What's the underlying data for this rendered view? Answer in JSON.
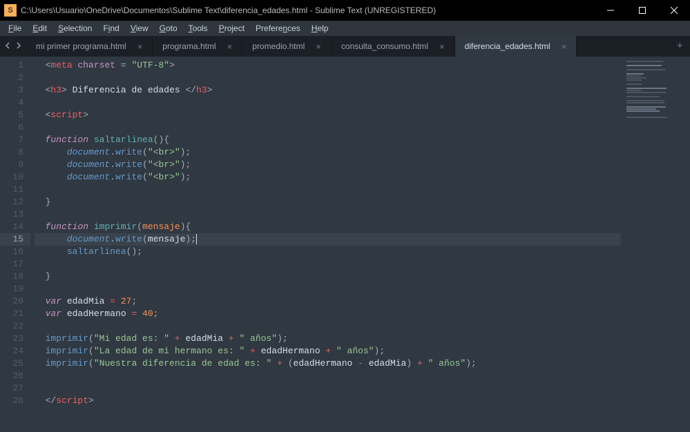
{
  "titlebar": {
    "icon_letter": "S",
    "title": "C:\\Users\\Usuario\\OneDrive\\Documentos\\Sublime Text\\diferencia_edades.html - Sublime Text (UNREGISTERED)"
  },
  "menu": {
    "file": "File",
    "file_u": "F",
    "edit": "Edit",
    "edit_u": "E",
    "selection": "Selection",
    "selection_u": "S",
    "find": "Find",
    "find_u": "i",
    "view": "View",
    "view_u": "V",
    "goto": "Goto",
    "goto_u": "G",
    "tools": "Tools",
    "tools_u": "T",
    "project": "Project",
    "project_u": "P",
    "preferences": "Preferences",
    "preferences_u": "n",
    "help": "Help",
    "help_u": "H"
  },
  "tabs": {
    "items": [
      {
        "label": "mi primer programa.html"
      },
      {
        "label": "programa.html"
      },
      {
        "label": "promedio.html"
      },
      {
        "label": "consulta_consumo.html"
      },
      {
        "label": "diferencia_edades.html"
      }
    ],
    "active_index": 4,
    "plus": "+"
  },
  "lines": {
    "count": 28,
    "highlight": 15
  },
  "code": {
    "l1": {
      "open": "<",
      "tag": "meta",
      "sp": " ",
      "attr": "charset",
      "eq": " = ",
      "str": "\"UTF-8\"",
      "close": ">"
    },
    "l3": {
      "open": "<",
      "tag": "h3",
      "close1": ">",
      "text": " Diferencia de edades ",
      "open2": "</",
      "tag2": "h3",
      "close2": ">"
    },
    "l5": {
      "open": "<",
      "tag": "script",
      "close": ">"
    },
    "l7": {
      "kw": "function",
      "sp": " ",
      "name": "saltarlinea",
      "p": "(){"
    },
    "l8": {
      "ind": "    ",
      "obj": "document",
      "dot": ".",
      "fn": "write",
      "po": "(",
      "str": "\"<br>\"",
      "pc": ");"
    },
    "l9": {
      "ind": "    ",
      "obj": "document",
      "dot": ".",
      "fn": "write",
      "po": "(",
      "str": "\"<br>\"",
      "pc": ");"
    },
    "l10": {
      "ind": "    ",
      "obj": "document",
      "dot": ".",
      "fn": "write",
      "po": "(",
      "str": "\"<br>\"",
      "pc": ");"
    },
    "l12": {
      "b": "}"
    },
    "l14": {
      "kw": "function",
      "sp": " ",
      "name": "imprimir",
      "po": "(",
      "param": "mensaje",
      "pc": "){"
    },
    "l15": {
      "ind": "    ",
      "obj": "document",
      "dot": ".",
      "fn": "write",
      "po": "(",
      "arg": "mensaje",
      "pc": ");"
    },
    "l16": {
      "ind": "    ",
      "fn": "saltarlinea",
      "p": "();"
    },
    "l18": {
      "b": "}"
    },
    "l20": {
      "kw": "var",
      "sp": " ",
      "name": "edadMia",
      "eq": " = ",
      "num": "27",
      "semi": ";"
    },
    "l21": {
      "kw": "var",
      "sp": " ",
      "name": "edadHermano",
      "eq": " = ",
      "num": "40",
      "semi": ";"
    },
    "l23": {
      "fn": "imprimir",
      "po": "(",
      "s1": "\"Mi edad es: \"",
      "op1": " + ",
      "v1": "edadMia",
      "op2": " + ",
      "s2": "\" años\"",
      "pc": ");"
    },
    "l24": {
      "fn": "imprimir",
      "po": "(",
      "s1": "\"La edad de mi hermano es: \"",
      "op1": " + ",
      "v1": "edadHermano",
      "op2": " + ",
      "s2": "\" años\"",
      "pc": ");"
    },
    "l25": {
      "fn": "imprimir",
      "po": "(",
      "s1": "\"Nuestra diferencia de edad es: \"",
      "op1": " + ",
      "lp": "(",
      "v1": "edadHermano",
      "op2": " - ",
      "v2": "edadMia",
      "rp": ")",
      "op3": " + ",
      "s2": "\" años\"",
      "pc": ");"
    },
    "l28": {
      "open": "</",
      "tag": "script",
      "close": ">"
    }
  }
}
